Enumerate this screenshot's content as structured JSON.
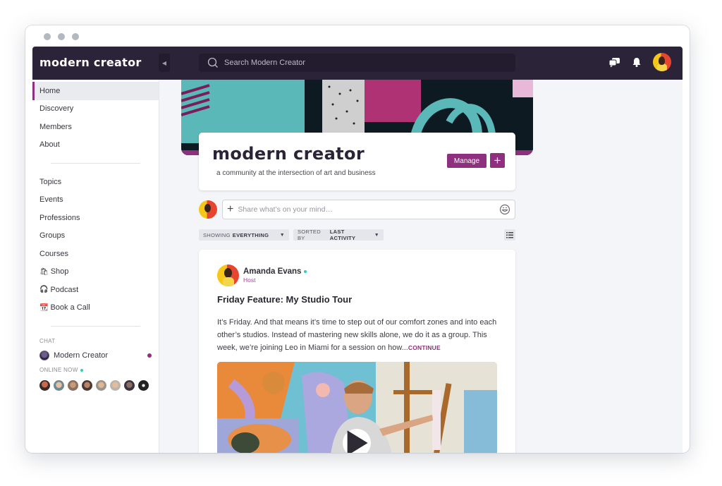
{
  "window": {
    "controls": [
      "close",
      "minimize",
      "maximize"
    ]
  },
  "topbar": {
    "brand": "modern creator",
    "collapse_icon": "caret-left-icon",
    "search_placeholder": "Search Modern Creator",
    "icons": [
      "chat-bubbles-icon",
      "bell-icon",
      "user-avatar"
    ]
  },
  "sidebar": {
    "primary": [
      {
        "label": "Home",
        "active": true
      },
      {
        "label": "Discovery"
      },
      {
        "label": "Members"
      },
      {
        "label": "About"
      }
    ],
    "secondary": [
      {
        "label": "Topics"
      },
      {
        "label": "Events"
      },
      {
        "label": "Professions"
      },
      {
        "label": "Groups"
      },
      {
        "label": "Courses"
      },
      {
        "label": "Shop",
        "emoji": "🛍"
      },
      {
        "label": "Podcast",
        "emoji": "🎧"
      },
      {
        "label": "Book a Call",
        "emoji": "📆"
      }
    ],
    "chat_label": "CHAT",
    "chat_name": "Modern Creator",
    "online_label": "ONLINE NOW",
    "online_count": 8
  },
  "community": {
    "title": "modern creator",
    "tagline": "a community at the intersection of art and business",
    "manage_label": "Manage",
    "add_label": "+"
  },
  "composer": {
    "placeholder": "Share what’s on your mind…"
  },
  "filters": {
    "showing_label": "SHOWING",
    "showing_value": "EVERYTHING",
    "sorted_label": "SORTED BY",
    "sorted_value": "LAST ACTIVITY"
  },
  "post": {
    "author": "Amanda Evans",
    "role": "Host",
    "title": "Friday Feature: My Studio Tour",
    "body": "It’s Friday. And that means it’s time to step out of our comfort zones and into each other’s studios. Instead of mastering new skills alone, we do it as a group. This week, we’re joining Leo in Miami for a session on how...",
    "continue_label": "CONTINUE"
  },
  "colors": {
    "topbar": "#2b2337",
    "accent": "#8e2f7f",
    "online": "#2fd1b0",
    "background": "#f4f5f9"
  }
}
